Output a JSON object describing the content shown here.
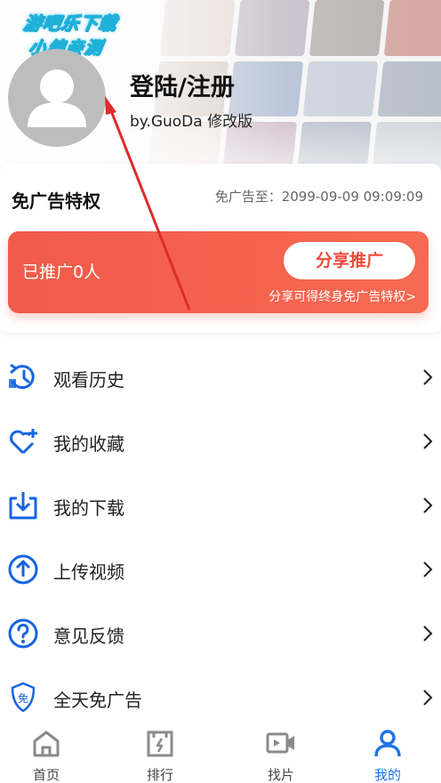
{
  "watermark": {
    "line1": "游吧乐下载",
    "line2": "小编亲测"
  },
  "profile": {
    "username": "登陆/注册",
    "subtitle": "by.GuoDa 修改版"
  },
  "vip_card": {
    "title": "免广告特权",
    "expire_text": "免广告至：2099-09-09 09:09:09",
    "promoted_count": "已推广0人",
    "share_button": "分享推广",
    "share_hint": "分享可得终身免广告特权>"
  },
  "menu": [
    {
      "label": "观看历史",
      "icon": "history-icon"
    },
    {
      "label": "我的收藏",
      "icon": "heart-plus-icon"
    },
    {
      "label": "我的下载",
      "icon": "download-icon"
    },
    {
      "label": "上传视频",
      "icon": "upload-icon"
    },
    {
      "label": "意见反馈",
      "icon": "question-icon"
    },
    {
      "label": "全天免广告",
      "icon": "ad-free-icon"
    }
  ],
  "tabbar": [
    {
      "label": "首页",
      "icon": "home-icon",
      "active": false
    },
    {
      "label": "排行",
      "icon": "ranking-icon",
      "active": false
    },
    {
      "label": "找片",
      "icon": "video-camera-icon",
      "active": false
    },
    {
      "label": "我的",
      "icon": "user-icon",
      "active": true
    }
  ],
  "colors": {
    "accent": "#1f73e8",
    "icon_blue": "#1565e0",
    "promo_red": "#f25a4a",
    "annotation_arrow": "#e02a2a"
  }
}
